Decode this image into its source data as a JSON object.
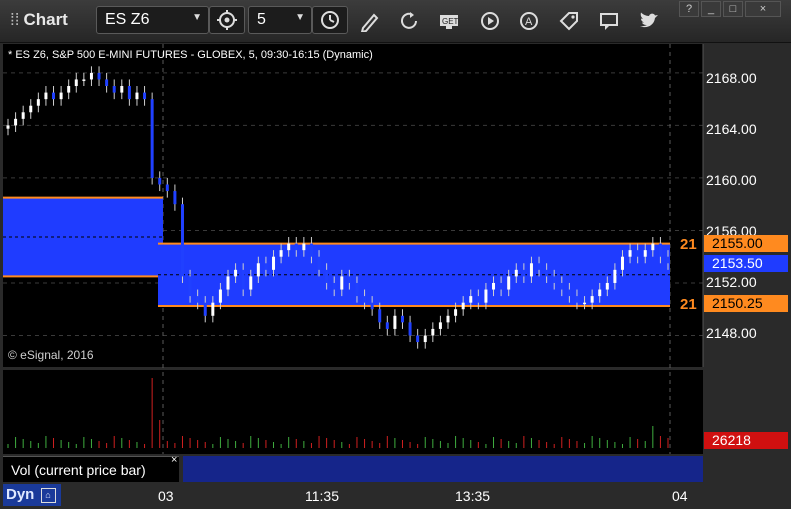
{
  "toolbar": {
    "title": "Chart",
    "symbol": "ES Z6",
    "interval": "5",
    "icons": [
      "settings-gear-icon",
      "clock-icon",
      "pencil-icon",
      "refresh-icon",
      "get-icon",
      "play-icon",
      "alert-icon",
      "tag-icon",
      "comment-icon",
      "twitter-icon"
    ]
  },
  "window_controls": [
    "?",
    "_",
    "□",
    "×"
  ],
  "chart_header": "* ES Z6, S&P 500 E-MINI FUTURES - GLOBEX, 5, 09:30-16:15 (Dynamic)",
  "copyright": "© eSignal, 2016",
  "volume_pane": {
    "label": "Vol (current price bar)",
    "close_symbol": "×",
    "last_volume": "26218"
  },
  "dyn_label": "Dyn",
  "price_tags": {
    "upper_line": "2155.00",
    "current": "2153.50",
    "lower_line": "2150.25",
    "upper_left_stub": "21",
    "lower_left_stub": "21"
  },
  "colors": {
    "bg": "#000000",
    "range_box": "#1f3cff",
    "range_line": "#ff8a1f",
    "vol_up": "#3fae3f",
    "vol_down": "#d02020",
    "current_tag": "#1f3cff"
  },
  "chart_data": {
    "type": "candlestick",
    "title": "* ES Z6, S&P 500 E-MINI FUTURES - GLOBEX, 5, 09:30-16:15 (Dynamic)",
    "y_ticks": [
      "2168.00",
      "2164.00",
      "2160.00",
      "2156.00",
      "2152.00",
      "2148.00"
    ],
    "ylim": [
      2145.6,
      2170.2
    ],
    "x_ticks": [
      "03",
      "11:35",
      "13:35",
      "04"
    ],
    "prev_day_range_box": {
      "high": 2158.5,
      "low": 2152.5
    },
    "today_range_box": {
      "high": 2155.0,
      "low": 2150.25
    },
    "last_price": 2153.5,
    "closes": [
      2164.0,
      2164.5,
      2165.0,
      2165.5,
      2166.0,
      2166.5,
      2166.0,
      2166.5,
      2167.0,
      2167.5,
      2167.5,
      2168.0,
      2167.5,
      2167.0,
      2166.5,
      2167.0,
      2166.0,
      2166.5,
      2166.0,
      2160.0,
      2159.5,
      2159.0,
      2158.0,
      2152.5,
      2151.0,
      2150.5,
      2149.5,
      2150.5,
      2151.5,
      2152.5,
      2153.0,
      2151.5,
      2152.5,
      2153.5,
      2153.0,
      2154.0,
      2154.5,
      2155.0,
      2154.5,
      2155.0,
      2154.0,
      2153.0,
      2152.0,
      2151.5,
      2152.5,
      2152.0,
      2151.0,
      2150.5,
      2150.0,
      2149.0,
      2148.5,
      2149.5,
      2149.0,
      2148.0,
      2147.5,
      2148.0,
      2148.5,
      2149.0,
      2149.5,
      2150.0,
      2150.5,
      2151.0,
      2150.5,
      2151.5,
      2152.0,
      2151.5,
      2152.5,
      2153.0,
      2152.5,
      2153.5,
      2153.0,
      2152.5,
      2152.0,
      2151.5,
      2151.0,
      2150.5,
      2150.5,
      2151.0,
      2151.5,
      2152.0,
      2153.0,
      2154.0,
      2154.5,
      2154.0,
      2154.5,
      2155.0,
      2154.0,
      2153.5
    ]
  }
}
